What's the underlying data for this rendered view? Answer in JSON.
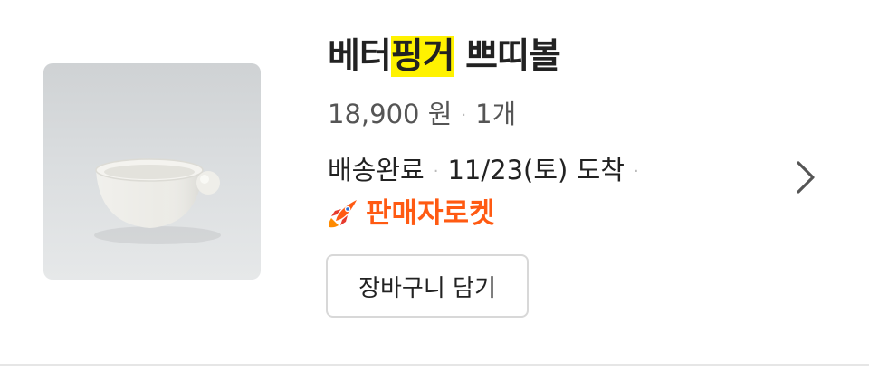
{
  "product": {
    "title_pre": "베터",
    "title_highlight": "핑거",
    "title_post": " 쁘띠볼",
    "price": "18,900 원",
    "separator": "·",
    "quantity": "1개"
  },
  "shipping": {
    "status": "배송완료",
    "arrival": "11/23(토) 도착",
    "separator": "·"
  },
  "badge": {
    "label": "판매자로켓",
    "icon": "rocket-icon",
    "color": "#ff5a12"
  },
  "actions": {
    "add_to_cart_label": "장바구니 담기"
  },
  "colors": {
    "highlight": "#fff200",
    "badge_text": "#ff5a12"
  }
}
